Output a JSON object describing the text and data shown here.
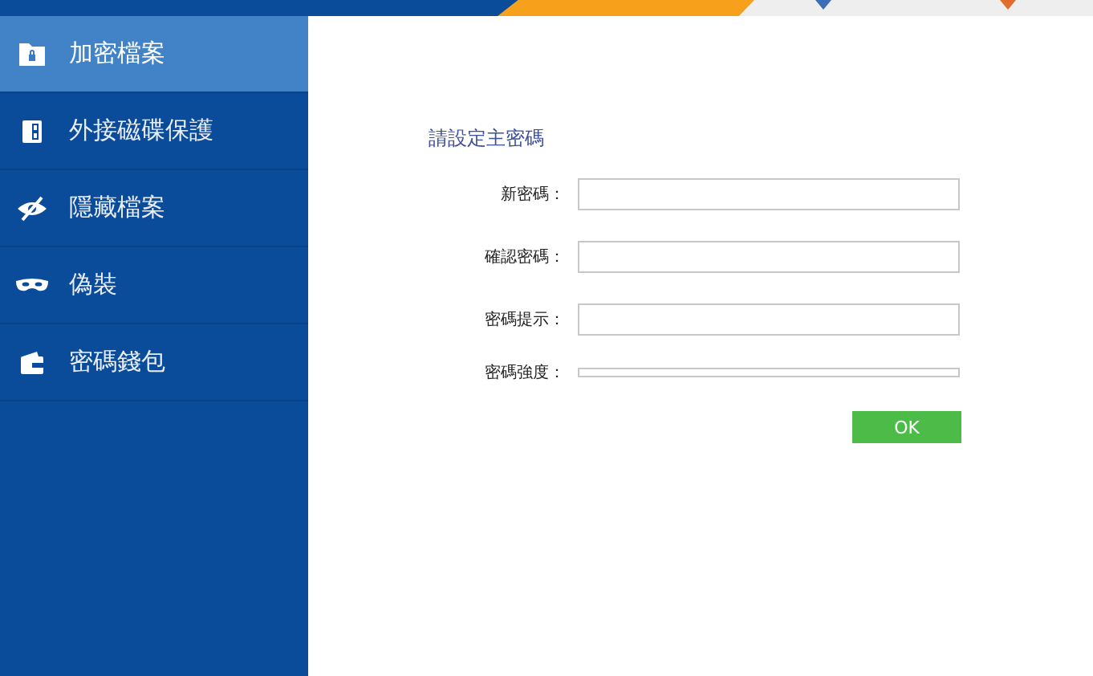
{
  "sidebar": {
    "items": [
      {
        "kind": "folder-lock",
        "label": "加密檔案",
        "selected": true
      },
      {
        "kind": "drive",
        "label": "外接磁碟保護",
        "selected": false
      },
      {
        "kind": "eye-off",
        "label": "隱藏檔案",
        "selected": false
      },
      {
        "kind": "mask",
        "label": "偽裝",
        "selected": false
      },
      {
        "kind": "wallet",
        "label": "密碼錢包",
        "selected": false
      }
    ]
  },
  "form": {
    "title": "請設定主密碼",
    "fields": [
      {
        "label": "新密碼："
      },
      {
        "label": "確認密碼："
      },
      {
        "label": "密碼提示："
      }
    ],
    "strength": {
      "label": "密碼強度：",
      "level": 0
    },
    "ok_button": "OK"
  }
}
